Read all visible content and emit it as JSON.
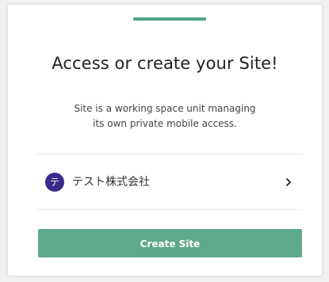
{
  "header": {
    "title": "Access or create your Site!",
    "subtitle_line1": "Site is a working space unit managing",
    "subtitle_line2": "its own private mobile access."
  },
  "sites": [
    {
      "avatar_initial": "テ",
      "name": "テスト株式会社",
      "avatar_color": "#3b2a8c"
    }
  ],
  "actions": {
    "create_label": "Create Site"
  },
  "colors": {
    "accent": "#4fa58a",
    "button": "#5ea98c"
  },
  "icons": {
    "chevron": "chevron-right-icon"
  }
}
